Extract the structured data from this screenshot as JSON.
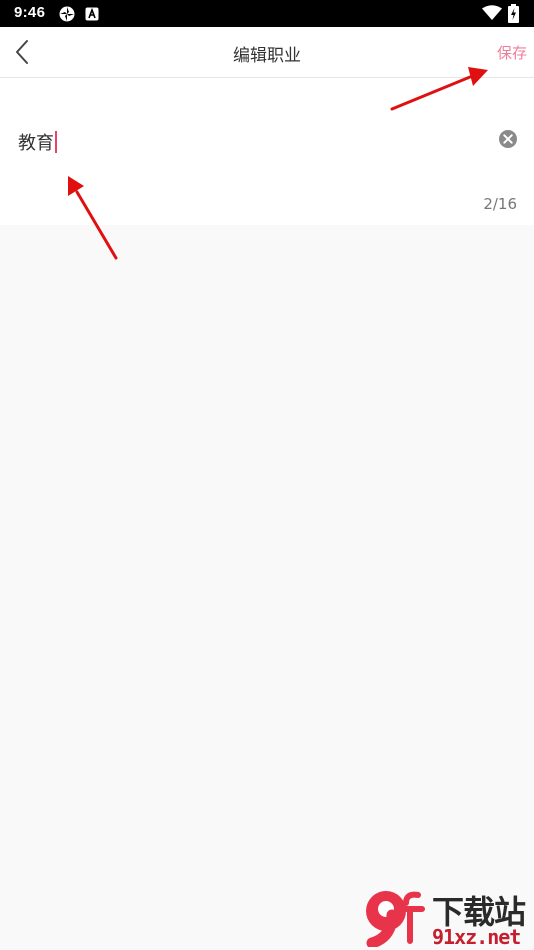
{
  "status_bar": {
    "time": "9:46",
    "icons": [
      "settings-icon",
      "app-a-icon",
      "wifi-icon",
      "battery-charging-icon"
    ]
  },
  "nav": {
    "back_icon": "chevron-left-icon",
    "title": "编辑职业",
    "save_label": "保存"
  },
  "editor": {
    "value": "教育",
    "clear_icon": "clear-circle-icon",
    "counter": "2/16"
  },
  "colors": {
    "accent": "#f07e9a",
    "caret": "#e8436a",
    "annotation_arrow": "#e01010",
    "background": "#f9f9f9"
  },
  "watermark": {
    "logo_text": "9f",
    "brand": "下载站",
    "url": "91xz.net"
  }
}
